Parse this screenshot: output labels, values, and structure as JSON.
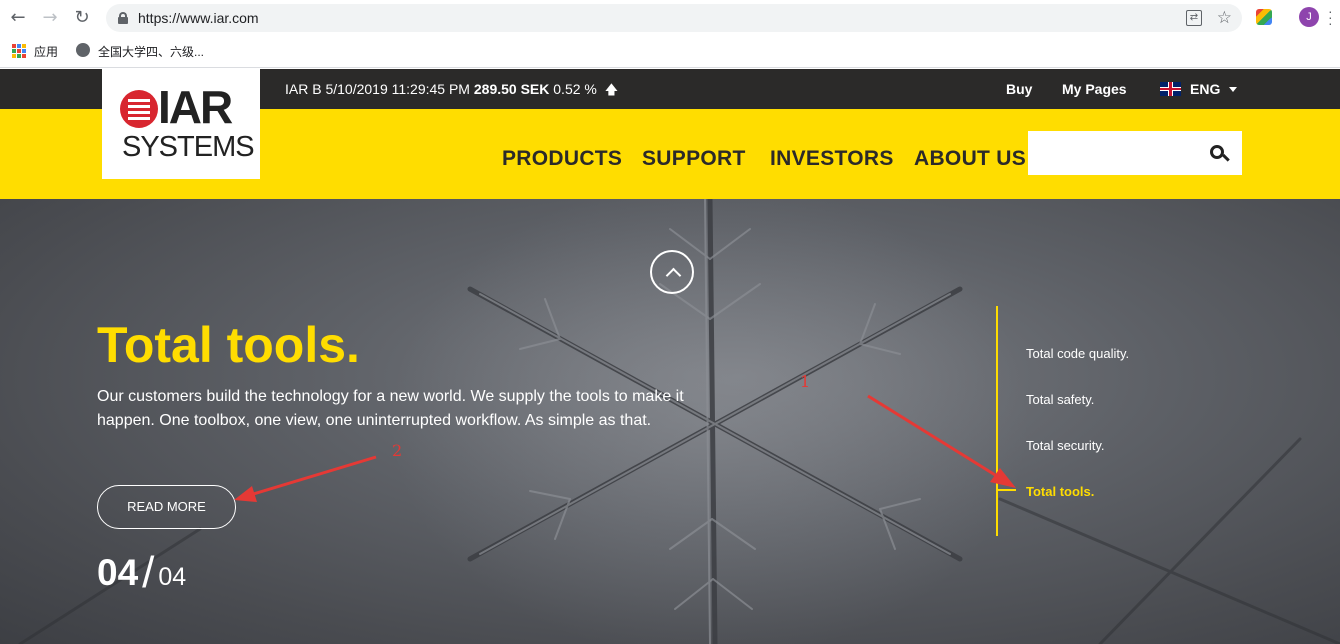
{
  "browser": {
    "url": "https://www.iar.com",
    "bookmarks": [
      {
        "label": "应用"
      },
      {
        "label": "全国大学四、六级..."
      }
    ],
    "profile_initial": "J",
    "icons": [
      "back-icon",
      "forward-icon",
      "reload-icon",
      "lock-icon",
      "translate-icon",
      "star-icon",
      "extension-icon",
      "profile-avatar",
      "menu-icon"
    ]
  },
  "topbar": {
    "ticker_prefix": "IAR B 5/10/2019 11:29:45 PM",
    "ticker_price": "289.50 SEK",
    "ticker_change": "0.52 %",
    "ticker_direction_icon": "arrow-up-icon",
    "buy": "Buy",
    "my_pages": "My Pages",
    "language": "ENG"
  },
  "logo": {
    "top": "IAR",
    "bottom": "SYSTEMS"
  },
  "nav": {
    "items": [
      "PRODUCTS",
      "SUPPORT",
      "INVESTORS",
      "ABOUT US"
    ],
    "search_placeholder": ""
  },
  "hero": {
    "title": "Total tools.",
    "text": "Our customers build the technology for a new world. We supply the tools to make it happen. One toolbox, one view, one uninterrupted workflow. As simple as that.",
    "button": "READ MORE",
    "slide_current": "04",
    "slide_separator": "/",
    "slide_total": "04"
  },
  "slide_nav": {
    "items": [
      "Total code quality.",
      "Total safety.",
      "Total security.",
      "Total tools."
    ],
    "active_index": 3
  },
  "annotations": [
    "1",
    "2"
  ],
  "colors": {
    "brand_yellow": "#ffdd00",
    "topbar_dark": "#2b2a29",
    "logo_red": "#d8262f",
    "annotation_red": "#e53935"
  }
}
